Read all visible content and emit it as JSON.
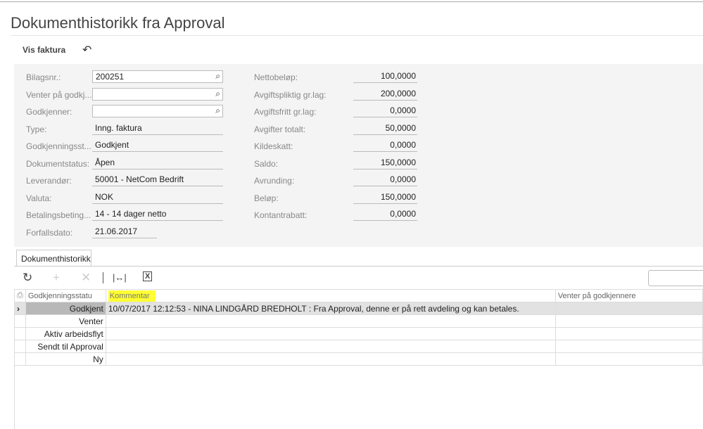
{
  "title": "Dokumenthistorikk fra Approval",
  "toolbar": {
    "vis_faktura": "Vis faktura",
    "undo_icon": "undo-icon"
  },
  "left_fields": [
    {
      "label": "Bilagsnr.:",
      "value": "200251",
      "type": "lookup"
    },
    {
      "label": "Venter på godkj...",
      "value": "",
      "type": "lookup"
    },
    {
      "label": "Godkjenner:",
      "value": "",
      "type": "lookup"
    },
    {
      "label": "Type:",
      "value": "Inng. faktura",
      "type": "ro"
    },
    {
      "label": "Godkjenningsst...",
      "value": "Godkjent",
      "type": "ro"
    },
    {
      "label": "Dokumentstatus:",
      "value": "Åpen",
      "type": "ro"
    },
    {
      "label": "Leverandør:",
      "value": "50001 - NetCom Bedrift",
      "type": "ro"
    },
    {
      "label": "Valuta:",
      "value": "NOK",
      "type": "ro"
    },
    {
      "label": "Betalingsbeting...",
      "value": "14 - 14 dager netto",
      "type": "ro"
    },
    {
      "label": "Forfallsdato:",
      "value": "21.06.2017",
      "type": "date"
    }
  ],
  "right_fields": [
    {
      "label": "Nettobeløp:",
      "value": "100,0000"
    },
    {
      "label": "Avgiftspliktig gr.lag:",
      "value": "200,0000"
    },
    {
      "label": "Avgiftsfritt gr.lag:",
      "value": "0,0000"
    },
    {
      "label": "Avgifter totalt:",
      "value": "50,0000"
    },
    {
      "label": "Kildeskatt:",
      "value": "0,0000"
    },
    {
      "label": "Saldo:",
      "value": "150,0000"
    },
    {
      "label": "Avrunding:",
      "value": "0,0000"
    },
    {
      "label": "Beløp:",
      "value": "150,0000"
    },
    {
      "label": "Kontantrabatt:",
      "value": "0,0000"
    }
  ],
  "tab": "Dokumenthistorikk",
  "grid": {
    "columns": [
      "Godkjenningsstatu",
      "Kommentar",
      "Venter på godkjennere"
    ],
    "highlight_color": "#ffff33",
    "rows": [
      {
        "status": "Godkjent",
        "comment": "10/07/2017 12:12:53 - NINA LINDGÅRD BREDHOLT : Fra Approval, denne er på rett avdeling og kan betales.",
        "waiting": ""
      },
      {
        "status": "Venter",
        "comment": "",
        "waiting": ""
      },
      {
        "status": "Aktiv arbeidsflyt",
        "comment": "",
        "waiting": ""
      },
      {
        "status": "Sendt til Approval",
        "comment": "",
        "waiting": ""
      },
      {
        "status": "Ny",
        "comment": "",
        "waiting": ""
      }
    ]
  }
}
